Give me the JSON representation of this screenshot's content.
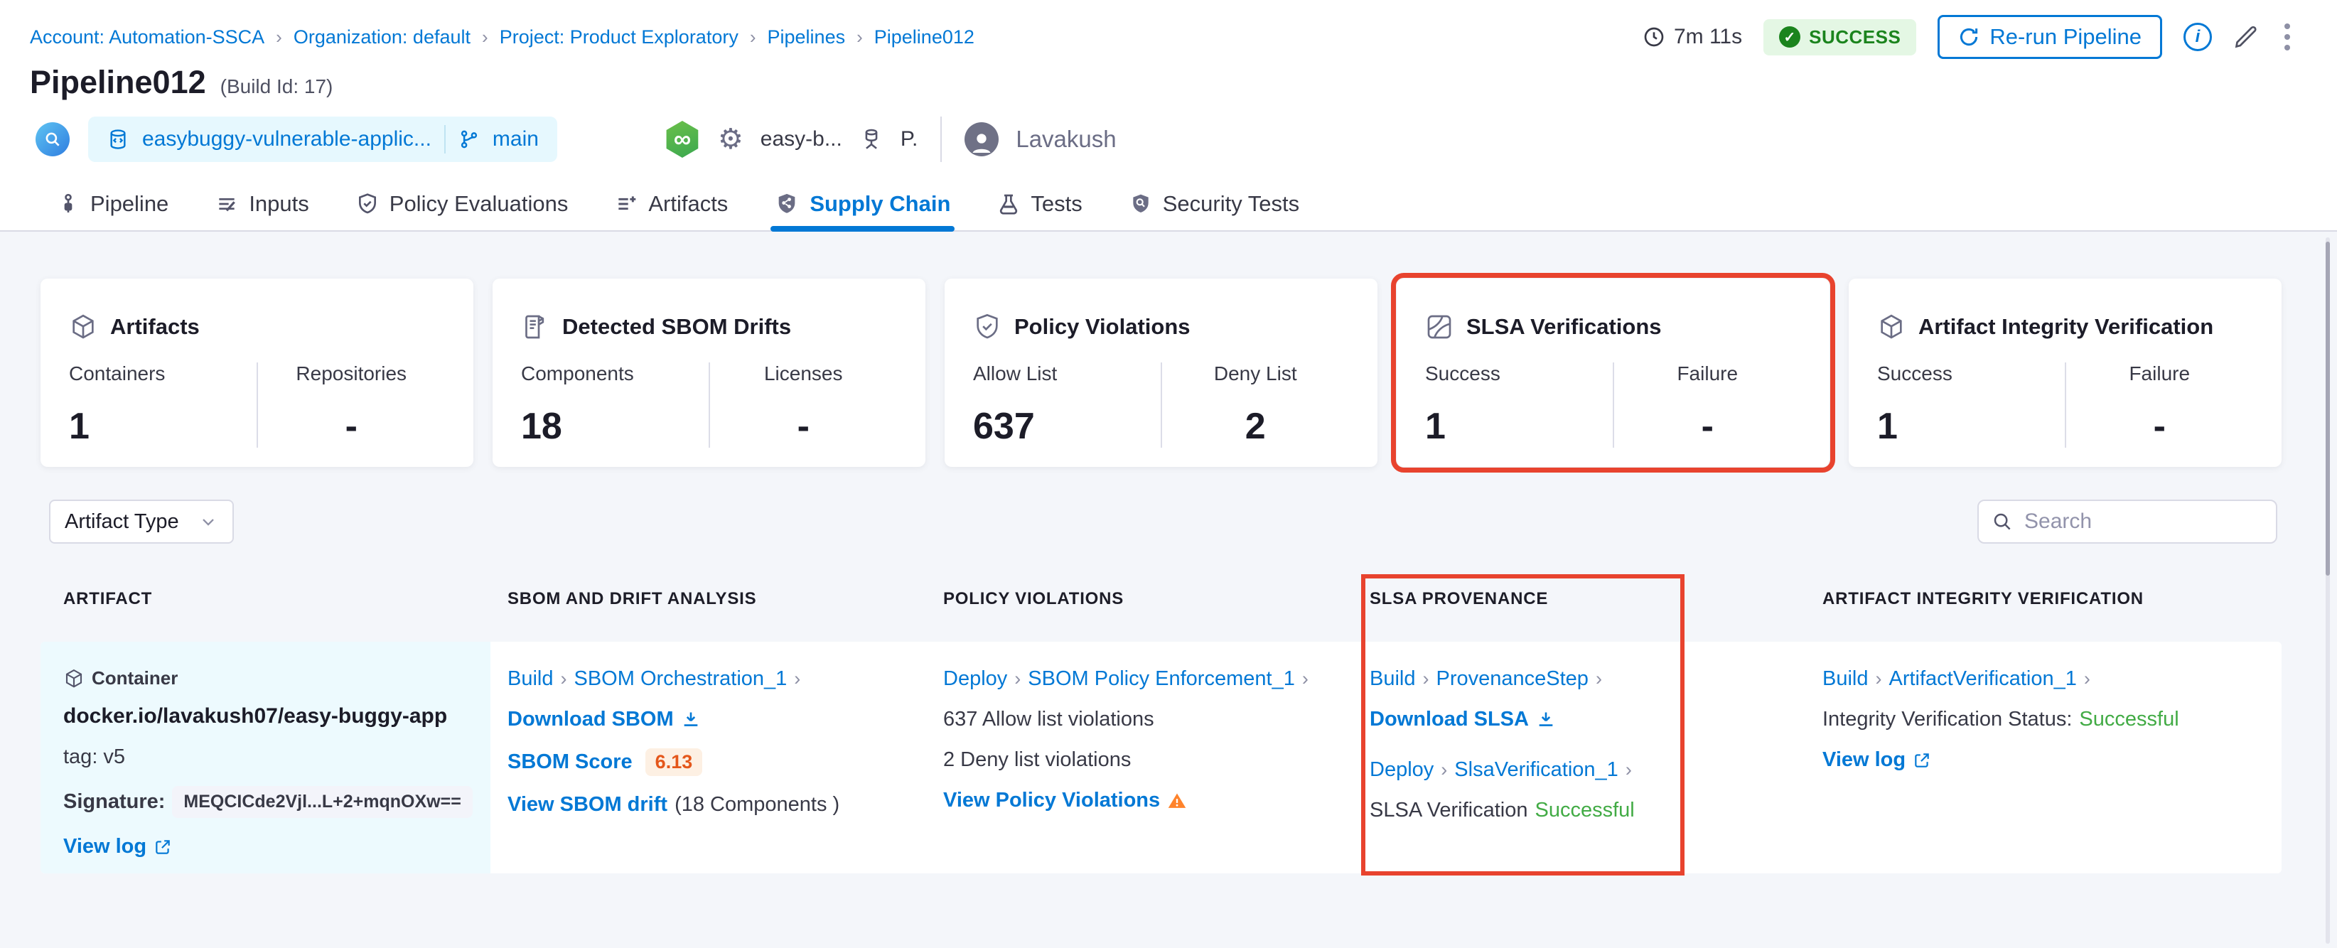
{
  "colors": {
    "primary_blue": "#0278d5",
    "success_badge_text": "#1b841d",
    "success_badge_bg": "#e4f7e4",
    "status_green_text": "#42ab45",
    "annotation_red": "#e8432e",
    "warning_orange": "#ff832b",
    "score_orange": "#e4571b",
    "page_bg": "#f4f6fa",
    "artifact_cell_bg": "#edfafe"
  },
  "breadcrumb": [
    "Account: Automation-SSCA",
    "Organization: default",
    "Project: Product Exploratory",
    "Pipelines",
    "Pipeline012"
  ],
  "header": {
    "title": "Pipeline012",
    "build_id": "(Build Id: 17)",
    "duration": "7m 11s",
    "status": "SUCCESS",
    "rerun_label": "Re-run Pipeline",
    "repo": "easybuggy-vulnerable-applic...",
    "branch": "main",
    "trigger_label": "easy-b...",
    "pipeline_short": "P.",
    "user": "Lavakush"
  },
  "tabs": [
    {
      "label": "Pipeline"
    },
    {
      "label": "Inputs"
    },
    {
      "label": "Policy Evaluations"
    },
    {
      "label": "Artifacts"
    },
    {
      "label": "Supply Chain"
    },
    {
      "label": "Tests"
    },
    {
      "label": "Security Tests"
    }
  ],
  "cards": [
    {
      "title": "Artifacts",
      "stats": [
        {
          "label": "Containers",
          "value": "1"
        },
        {
          "label": "Repositories",
          "value": "-"
        }
      ]
    },
    {
      "title": "Detected SBOM Drifts",
      "stats": [
        {
          "label": "Components",
          "value": "18"
        },
        {
          "label": "Licenses",
          "value": "-"
        }
      ]
    },
    {
      "title": "Policy Violations",
      "stats": [
        {
          "label": "Allow List",
          "value": "637"
        },
        {
          "label": "Deny List",
          "value": "2"
        }
      ]
    },
    {
      "title": "SLSA Verifications",
      "stats": [
        {
          "label": "Success",
          "value": "1"
        },
        {
          "label": "Failure",
          "value": "-"
        }
      ]
    },
    {
      "title": "Artifact Integrity Verification",
      "stats": [
        {
          "label": "Success",
          "value": "1"
        },
        {
          "label": "Failure",
          "value": "-"
        }
      ]
    }
  ],
  "filters": {
    "artifact_type": "Artifact Type",
    "search_placeholder": "Search"
  },
  "table": {
    "headers": [
      "ARTIFACT",
      "SBOM AND DRIFT ANALYSIS",
      "POLICY VIOLATIONS",
      "SLSA PROVENANCE",
      "ARTIFACT INTEGRITY VERIFICATION"
    ],
    "row": {
      "artifact": {
        "type": "Container",
        "name": "docker.io/lavakush07/easy-buggy-app",
        "tag": "tag: v5",
        "signature_label": "Signature:",
        "signature": "MEQCICde2Vjl...L+2+mqnOXw==",
        "view_log": "View log"
      },
      "sbom": {
        "stage": "Build",
        "step": "SBOM Orchestration_1",
        "download": "Download SBOM",
        "score_label": "SBOM Score",
        "score": "6.13",
        "drift_link": "View SBOM drift",
        "components": "(18 Components )"
      },
      "policy": {
        "stage": "Deploy",
        "step": "SBOM Policy Enforcement_1",
        "allow": "637 Allow list violations",
        "deny": "2 Deny list violations",
        "view": "View Policy Violations"
      },
      "slsa": {
        "stage1": "Build",
        "step1": "ProvenanceStep",
        "download": "Download SLSA",
        "stage2": "Deploy",
        "step2": "SlsaVerification_1",
        "status_label": "SLSA Verification",
        "status": "Successful"
      },
      "integrity": {
        "stage": "Build",
        "step": "ArtifactVerification_1",
        "status_label": "Integrity Verification Status:",
        "status": "Successful",
        "view_log": "View log"
      }
    }
  }
}
